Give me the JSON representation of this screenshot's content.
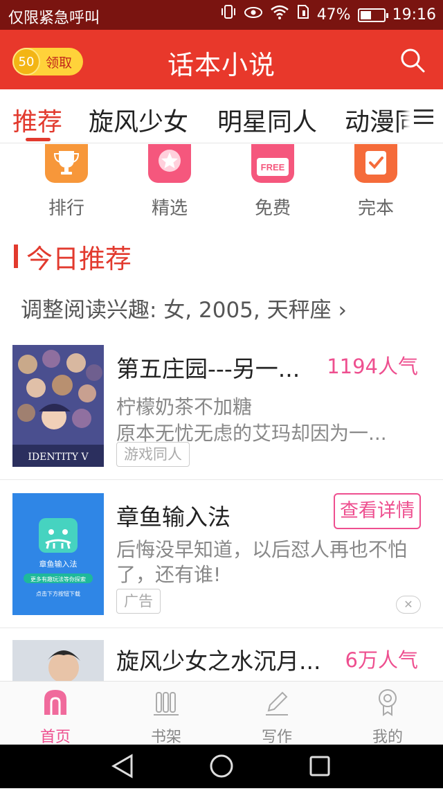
{
  "status_bar": {
    "carrier": "仅限紧急呼叫",
    "battery": "47%",
    "time": "19:16"
  },
  "app_bar": {
    "coin_count": "50",
    "coin_label": "领取",
    "title": "话本小说"
  },
  "tabs": [
    {
      "label": "推荐",
      "active": true
    },
    {
      "label": "旋风少女"
    },
    {
      "label": "明星同人"
    },
    {
      "label": "动漫同"
    }
  ],
  "categories": [
    {
      "label": "排行",
      "icon": "trophy-icon",
      "color": "#f7973a"
    },
    {
      "label": "精选",
      "icon": "star-icon",
      "color": "#f5577d"
    },
    {
      "label": "免费",
      "icon": "free-icon",
      "color": "#f5577d",
      "badge": "FREE"
    },
    {
      "label": "完本",
      "icon": "check-icon",
      "color": "#f56b3a"
    }
  ],
  "section": {
    "title": "今日推荐",
    "interest_text": "调整阅读兴趣: 女, 2005, 天秤座 ›"
  },
  "books": [
    {
      "title": "第五庄园---另一...",
      "popularity": "1194人气",
      "author": "柠檬奶茶不加糖",
      "summary": "原本无忧无虑的艾玛却因为一...",
      "tag": "游戏同人",
      "cover_text": "IDENTITY V"
    },
    {
      "title": "章鱼输入法",
      "button": "查看详情",
      "summary_line1": "后悔没早知道，以后怼人再也不怕",
      "summary_line2": "了，还有谁!",
      "tag": "广告",
      "close": "✕",
      "ad_app_name": "章鱼输入法",
      "ad_slogan": "更多有趣玩法等你探索",
      "ad_hint": "点击下方按钮下载"
    },
    {
      "title": "旋风少女之水沉月...",
      "popularity": "6万人气"
    }
  ],
  "bottom_nav": [
    {
      "label": "首页",
      "icon": "home-icon",
      "active": true
    },
    {
      "label": "书架",
      "icon": "bookshelf-icon"
    },
    {
      "label": "写作",
      "icon": "pen-icon"
    },
    {
      "label": "我的",
      "icon": "profile-icon"
    }
  ],
  "colors": {
    "primary": "#e8382b",
    "accent": "#ee4f8f",
    "status_bar": "#7a1410"
  }
}
